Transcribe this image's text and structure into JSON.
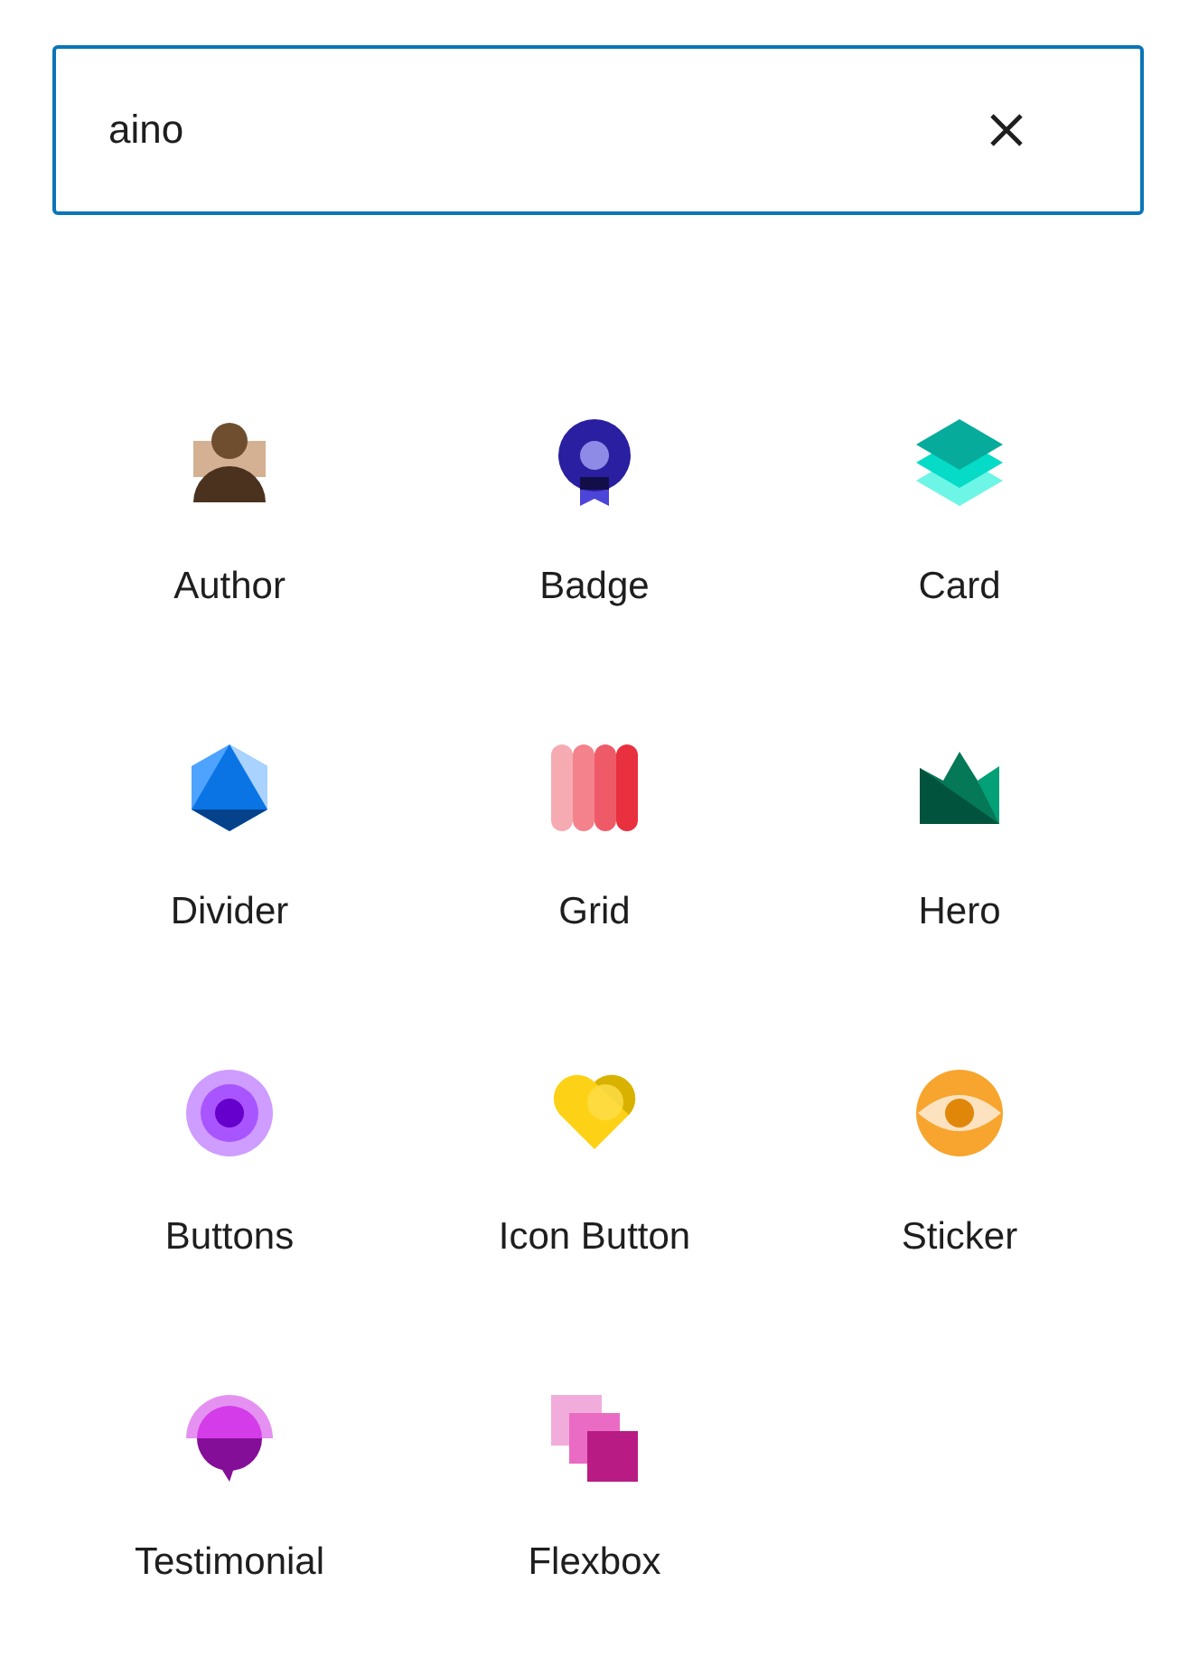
{
  "search": {
    "value": "aino",
    "clearable": true
  },
  "blocks": [
    {
      "label": "Author"
    },
    {
      "label": "Badge"
    },
    {
      "label": "Card"
    },
    {
      "label": "Divider"
    },
    {
      "label": "Grid"
    },
    {
      "label": "Hero"
    },
    {
      "label": "Buttons"
    },
    {
      "label": "Icon Button"
    },
    {
      "label": "Sticker"
    },
    {
      "label": "Testimonial"
    },
    {
      "label": "Flexbox"
    }
  ]
}
